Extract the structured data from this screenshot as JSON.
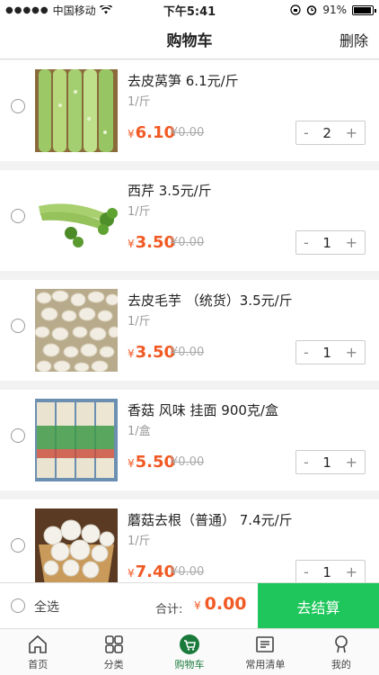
{
  "status": {
    "carrier": "中国移动",
    "time": "下午5:41",
    "battery": "91%"
  },
  "nav": {
    "title": "购物车",
    "action": "删除"
  },
  "items": [
    {
      "name": "去皮莴笋 6.1元/斤",
      "unit": "1/斤",
      "price": "6.10",
      "old_price": "0.00",
      "qty": "2"
    },
    {
      "name": "西芹 3.5元/斤",
      "unit": "1/斤",
      "price": "3.50",
      "old_price": "0.00",
      "qty": "1"
    },
    {
      "name": "去皮毛芋 （统货）3.5元/斤",
      "unit": "1/斤",
      "price": "3.50",
      "old_price": "0.00",
      "qty": "1"
    },
    {
      "name": "香菇 风味 挂面 900克/盒",
      "unit": "1/盒",
      "price": "5.50",
      "old_price": "0.00",
      "qty": "1"
    },
    {
      "name": "蘑菇去根（普通） 7.4元/斤",
      "unit": "1/斤",
      "price": "7.40",
      "old_price": "0.00",
      "qty": "1"
    }
  ],
  "currency": "¥",
  "minus": "-",
  "plus": "+",
  "footer": {
    "select_all": "全选",
    "total_label": "合计:",
    "total": "0.00",
    "checkout": "去结算"
  },
  "tabs": [
    {
      "label": "首页",
      "icon": "home-icon"
    },
    {
      "label": "分类",
      "icon": "grid-icon"
    },
    {
      "label": "购物车",
      "icon": "cart-icon"
    },
    {
      "label": "常用清单",
      "icon": "list-icon"
    },
    {
      "label": "我的",
      "icon": "user-icon"
    }
  ],
  "colors": {
    "accent": "#1ec65b",
    "price": "#f15a24",
    "tab_active": "#1a7a3c"
  }
}
